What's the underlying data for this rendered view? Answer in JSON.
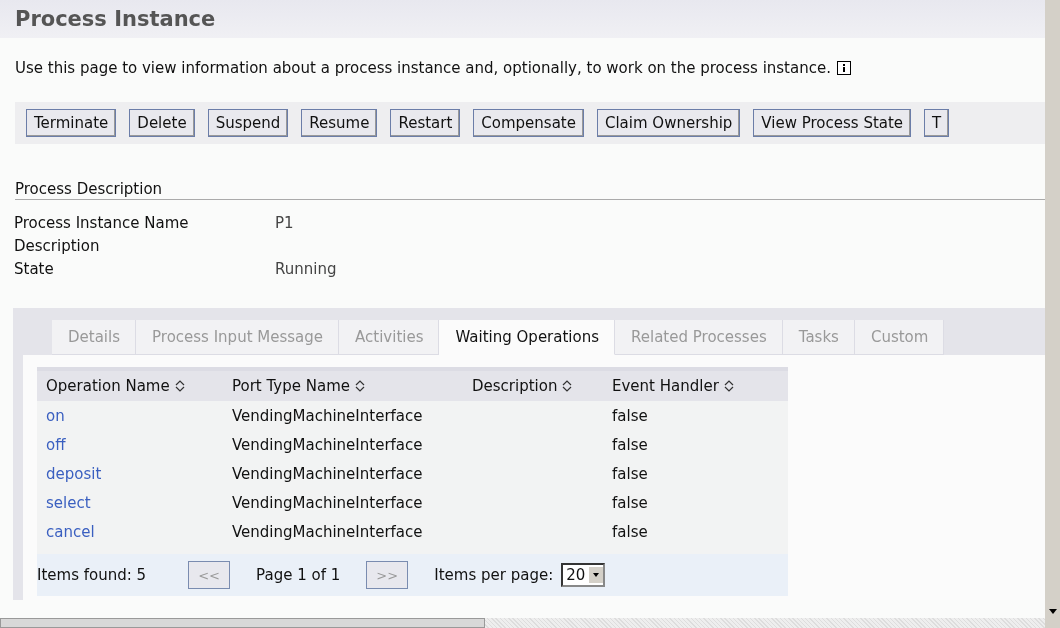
{
  "page": {
    "title": "Process Instance",
    "description": "Use this page to view information about a process instance and, optionally, to work on the process instance."
  },
  "buttons": [
    "Terminate",
    "Delete",
    "Suspend",
    "Resume",
    "Restart",
    "Compensate",
    "Claim Ownership",
    "View Process State",
    "T"
  ],
  "section": {
    "title": "Process Description"
  },
  "fields": [
    {
      "label": "Process Instance Name",
      "value": "P1"
    },
    {
      "label": "Description"
    },
    {
      "label": "State",
      "value": "Running"
    }
  ],
  "tabs": [
    {
      "label": "Details",
      "selected": false
    },
    {
      "label": "Process Input Message",
      "selected": false
    },
    {
      "label": "Activities",
      "selected": false
    },
    {
      "label": "Waiting Operations",
      "selected": true
    },
    {
      "label": "Related Processes",
      "selected": false
    },
    {
      "label": "Tasks",
      "selected": false
    },
    {
      "label": "Custom",
      "selected": false
    }
  ],
  "table": {
    "columns": [
      "Operation Name",
      "Port Type Name",
      "Description",
      "Event Handler"
    ],
    "rows": [
      [
        "on",
        "VendingMachineInterface",
        "",
        "false"
      ],
      [
        "off",
        "VendingMachineInterface",
        "",
        "false"
      ],
      [
        "deposit",
        "VendingMachineInterface",
        "",
        "false"
      ],
      [
        "select",
        "VendingMachineInterface",
        "",
        "false"
      ],
      [
        "cancel",
        "VendingMachineInterface",
        "",
        "false"
      ]
    ]
  },
  "pager": {
    "items_found": "Items found: 5",
    "prev": "<<",
    "page": "Page 1 of 1",
    "next": ">>",
    "per_page_label": "Items per page:",
    "per_page": "20"
  }
}
